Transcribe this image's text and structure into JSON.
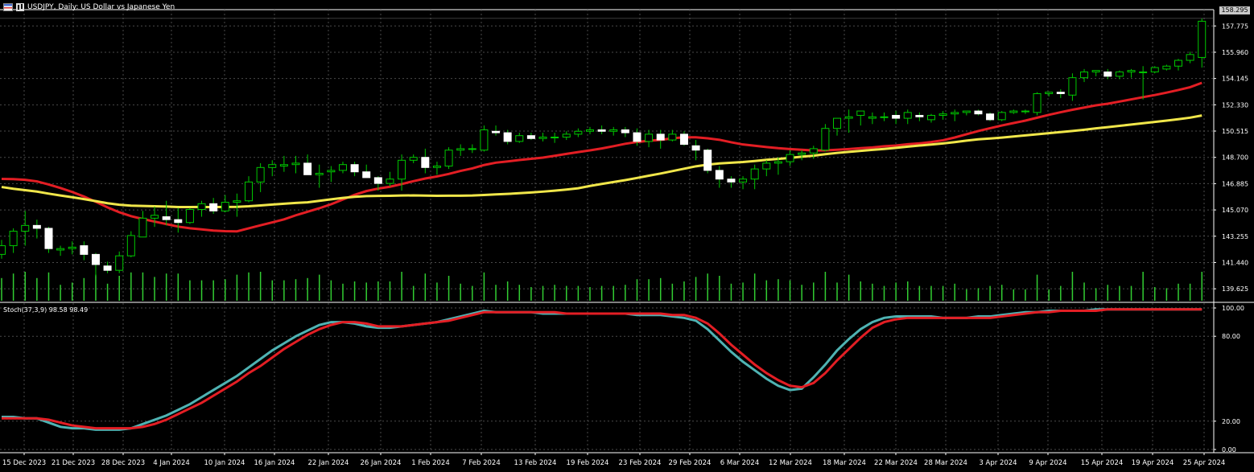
{
  "header": {
    "title": "USDJPY, Daily:  US Dollar vs Japanese Yen",
    "icons": [
      "symbol-list-icon",
      "chart-window-icon"
    ]
  },
  "price_axis": {
    "labels": [
      "157.775",
      "155.960",
      "154.145",
      "152.330",
      "150.515",
      "148.700",
      "146.885",
      "145.070",
      "143.255",
      "141.440",
      "139.625"
    ],
    "current_price": "158.295"
  },
  "stoch_axis": {
    "labels": [
      "100.00",
      "80.00",
      "20.00",
      "0.00"
    ]
  },
  "stoch_label": "Stoch(37,3,9) 98.58 98.49",
  "time_axis": {
    "labels": [
      "15 Dec 2023",
      "21 Dec 2023",
      "28 Dec 2023",
      "4 Jan 2024",
      "10 Jan 2024",
      "16 Jan 2024",
      "22 Jan 2024",
      "26 Jan 2024",
      "1 Feb 2024",
      "7 Feb 2024",
      "13 Feb 2024",
      "19 Feb 2024",
      "23 Feb 2024",
      "29 Feb 2024",
      "6 Mar 2024",
      "12 Mar 2024",
      "18 Mar 2024",
      "22 Mar 2024",
      "28 Mar 2024",
      "3 Apr 2024",
      "9 Apr 2024",
      "15 Apr 2024",
      "19 Apr 2024",
      "25 Apr 2024"
    ]
  },
  "colors": {
    "background": "#000000",
    "grid": "#4a4a4a",
    "candle": "#ffffff",
    "wick": "#00c800",
    "volume": "#32cd32",
    "ma_fast": "#e31e24",
    "ma_slow": "#f0e64a",
    "stoch_main": "#4fb3b3",
    "stoch_signal": "#e31e24"
  },
  "chart_data": [
    {
      "type": "candlestick",
      "title": "USDJPY, Daily:  US Dollar vs Japanese Yen",
      "ylim": [
        138.8,
        158.9
      ],
      "candles": [
        [
          142.0,
          143.0,
          141.7,
          142.6
        ],
        [
          142.6,
          143.8,
          142.1,
          143.6
        ],
        [
          143.6,
          145.0,
          142.6,
          144.0
        ],
        [
          144.0,
          144.4,
          143.1,
          143.8
        ],
        [
          143.8,
          143.9,
          142.1,
          142.4
        ],
        [
          142.3,
          142.6,
          141.9,
          142.4
        ],
        [
          142.4,
          142.9,
          142.0,
          142.5
        ],
        [
          142.6,
          142.9,
          141.6,
          142.0
        ],
        [
          142.0,
          142.1,
          140.5,
          141.3
        ],
        [
          141.2,
          141.5,
          140.7,
          140.9
        ],
        [
          140.9,
          142.2,
          140.7,
          141.9
        ],
        [
          141.9,
          143.6,
          141.8,
          143.3
        ],
        [
          143.2,
          145.0,
          143.2,
          144.5
        ],
        [
          144.5,
          145.3,
          143.9,
          144.7
        ],
        [
          144.6,
          145.7,
          144.0,
          144.4
        ],
        [
          144.4,
          145.2,
          143.5,
          144.2
        ],
        [
          144.2,
          145.2,
          144.1,
          145.1
        ],
        [
          145.1,
          145.7,
          144.6,
          145.5
        ],
        [
          145.5,
          145.9,
          144.8,
          145.0
        ],
        [
          145.0,
          146.1,
          144.9,
          145.6
        ],
        [
          145.6,
          146.2,
          144.6,
          145.7
        ],
        [
          145.7,
          147.4,
          145.6,
          147.0
        ],
        [
          147.0,
          148.3,
          146.3,
          148.0
        ],
        [
          148.0,
          148.5,
          147.4,
          148.2
        ],
        [
          148.1,
          148.8,
          147.7,
          148.2
        ],
        [
          148.2,
          148.8,
          147.6,
          148.3
        ],
        [
          148.3,
          148.9,
          147.6,
          147.5
        ],
        [
          147.5,
          148.2,
          146.6,
          147.6
        ],
        [
          147.7,
          148.1,
          147.0,
          147.8
        ],
        [
          147.8,
          148.4,
          147.6,
          148.2
        ],
        [
          148.2,
          148.4,
          147.4,
          147.7
        ],
        [
          147.7,
          148.2,
          147.3,
          147.3
        ],
        [
          147.3,
          147.4,
          146.4,
          146.9
        ],
        [
          146.9,
          147.7,
          146.7,
          147.2
        ],
        [
          147.2,
          148.9,
          146.4,
          148.5
        ],
        [
          148.5,
          148.9,
          148.3,
          148.7
        ],
        [
          148.7,
          149.3,
          147.6,
          148.0
        ],
        [
          148.0,
          148.4,
          147.5,
          148.1
        ],
        [
          148.1,
          149.4,
          147.9,
          149.2
        ],
        [
          149.2,
          149.6,
          148.8,
          149.3
        ],
        [
          149.3,
          149.6,
          149.0,
          149.3
        ],
        [
          149.2,
          150.9,
          149.1,
          150.6
        ],
        [
          150.5,
          150.9,
          150.2,
          150.4
        ],
        [
          150.4,
          150.6,
          149.6,
          149.8
        ],
        [
          149.8,
          150.4,
          149.7,
          150.2
        ],
        [
          150.2,
          150.4,
          149.9,
          150.0
        ],
        [
          150.0,
          150.4,
          149.8,
          150.1
        ],
        [
          150.1,
          150.4,
          149.7,
          150.1
        ],
        [
          150.1,
          150.5,
          149.9,
          150.3
        ],
        [
          150.3,
          150.7,
          150.1,
          150.5
        ],
        [
          150.5,
          150.8,
          150.3,
          150.6
        ],
        [
          150.6,
          150.9,
          150.3,
          150.5
        ],
        [
          150.5,
          150.8,
          150.2,
          150.6
        ],
        [
          150.6,
          150.8,
          150.1,
          150.4
        ],
        [
          150.4,
          150.7,
          149.5,
          149.8
        ],
        [
          149.8,
          150.6,
          149.4,
          150.3
        ],
        [
          150.3,
          150.6,
          149.3,
          149.9
        ],
        [
          149.9,
          150.6,
          149.8,
          150.3
        ],
        [
          150.3,
          150.5,
          149.5,
          149.6
        ],
        [
          149.5,
          149.9,
          148.5,
          149.2
        ],
        [
          149.2,
          149.3,
          147.6,
          147.8
        ],
        [
          147.8,
          148.1,
          146.6,
          147.2
        ],
        [
          147.2,
          147.4,
          146.6,
          147.0
        ],
        [
          147.0,
          147.4,
          146.5,
          147.2
        ],
        [
          147.2,
          148.2,
          146.5,
          147.9
        ],
        [
          147.9,
          148.5,
          147.4,
          148.3
        ],
        [
          148.3,
          148.7,
          147.5,
          148.4
        ],
        [
          148.4,
          149.2,
          148.1,
          148.9
        ],
        [
          148.9,
          149.2,
          148.5,
          149.0
        ],
        [
          149.0,
          149.5,
          148.6,
          149.3
        ],
        [
          149.2,
          151.0,
          149.1,
          150.7
        ],
        [
          150.7,
          151.1,
          150.2,
          151.4
        ],
        [
          151.4,
          152.0,
          150.4,
          151.5
        ],
        [
          151.6,
          151.9,
          150.9,
          151.9
        ],
        [
          151.4,
          151.8,
          151.0,
          151.5
        ],
        [
          151.5,
          151.8,
          151.2,
          151.5
        ],
        [
          151.6,
          151.9,
          151.0,
          151.4
        ],
        [
          151.4,
          152.0,
          151.0,
          151.8
        ],
        [
          151.6,
          151.8,
          151.2,
          151.5
        ],
        [
          151.3,
          151.7,
          151.1,
          151.6
        ],
        [
          151.6,
          151.9,
          151.3,
          151.7
        ],
        [
          151.7,
          152.0,
          151.2,
          151.8
        ],
        [
          151.8,
          151.9,
          151.6,
          151.9
        ],
        [
          151.9,
          152.0,
          151.6,
          151.7
        ],
        [
          151.7,
          151.8,
          151.2,
          151.3
        ],
        [
          151.3,
          151.9,
          151.2,
          151.8
        ],
        [
          151.8,
          152.0,
          151.7,
          151.9
        ],
        [
          151.9,
          152.0,
          151.7,
          151.9
        ],
        [
          151.8,
          153.2,
          151.6,
          153.1
        ],
        [
          153.1,
          153.2,
          152.9,
          153.2
        ],
        [
          153.2,
          153.4,
          152.8,
          153.1
        ],
        [
          153.0,
          154.5,
          152.6,
          154.2
        ],
        [
          154.2,
          154.8,
          153.9,
          154.6
        ],
        [
          154.6,
          154.7,
          154.3,
          154.7
        ],
        [
          154.6,
          154.8,
          154.1,
          154.3
        ],
        [
          154.3,
          154.7,
          154.1,
          154.6
        ],
        [
          154.6,
          154.8,
          154.2,
          154.7
        ],
        [
          154.6,
          155.0,
          152.7,
          154.6
        ],
        [
          154.6,
          155.0,
          154.5,
          154.9
        ],
        [
          154.8,
          155.1,
          154.7,
          155.0
        ],
        [
          155.0,
          155.5,
          154.7,
          155.4
        ],
        [
          155.4,
          156.0,
          155.2,
          155.8
        ],
        [
          155.6,
          158.3,
          154.9,
          158.1
        ]
      ]
    },
    {
      "type": "line",
      "title": "Stoch(37,3,9) 98.58 98.49",
      "ylim": [
        0,
        100
      ],
      "series": [
        {
          "values": [
            23,
            23,
            22,
            22,
            19,
            16,
            15,
            15,
            14,
            14,
            14,
            15,
            18,
            21,
            24,
            28,
            32,
            37,
            42,
            47,
            52,
            58,
            64,
            70,
            75,
            80,
            84,
            88,
            90,
            90,
            89,
            87,
            86,
            86,
            87,
            88,
            89,
            90,
            92,
            94,
            96,
            98,
            97,
            97,
            97,
            97,
            96,
            96,
            96,
            96,
            96,
            96,
            96,
            96,
            95,
            95,
            95,
            94,
            93,
            91,
            85,
            77,
            69,
            62,
            56,
            50,
            45,
            42,
            43,
            51,
            60,
            70,
            78,
            85,
            90,
            93,
            94,
            94,
            94,
            94,
            93,
            93,
            93,
            94,
            94,
            95,
            96,
            97,
            97,
            98,
            98,
            98,
            98,
            99,
            99,
            99,
            99,
            99,
            99,
            99,
            99,
            99,
            99
          ]
        },
        {
          "values": [
            22,
            22,
            22,
            22,
            21,
            19,
            17,
            16,
            15,
            15,
            15,
            15,
            16,
            18,
            21,
            25,
            29,
            33,
            38,
            43,
            48,
            54,
            59,
            65,
            71,
            76,
            81,
            85,
            88,
            90,
            90,
            89,
            87,
            87,
            87,
            88,
            89,
            90,
            91,
            93,
            95,
            97,
            97,
            97,
            97,
            97,
            97,
            97,
            96,
            96,
            96,
            96,
            96,
            96,
            96,
            96,
            96,
            95,
            95,
            93,
            89,
            82,
            74,
            67,
            60,
            54,
            49,
            45,
            44,
            47,
            54,
            63,
            71,
            79,
            86,
            90,
            92,
            93,
            93,
            93,
            93,
            93,
            93,
            93,
            93,
            94,
            95,
            96,
            97,
            97,
            98,
            98,
            98,
            98,
            99,
            99,
            99,
            99,
            99,
            99,
            99,
            99,
            99
          ]
        }
      ]
    }
  ]
}
